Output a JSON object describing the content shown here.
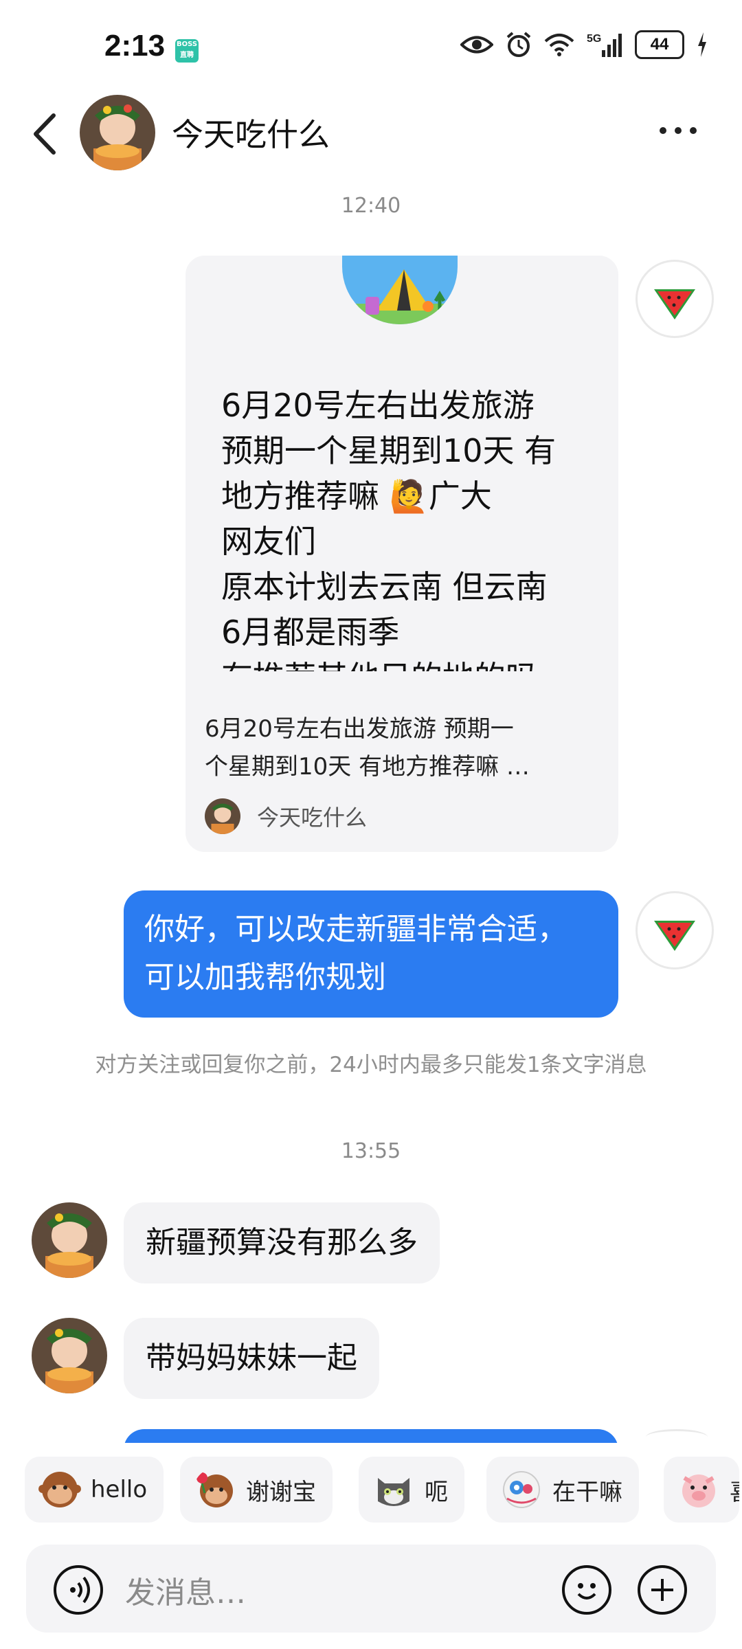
{
  "status_bar": {
    "time": "2:13",
    "boss_badge": "BOSS直聘",
    "network": "5G",
    "battery": "44"
  },
  "header": {
    "title": "今天吃什么",
    "back_icon": "chevron-left-icon",
    "more_icon": "more-dots-icon"
  },
  "messages": {
    "time_1": "12:40",
    "shared_card": {
      "body_lines": [
        "6月20号左右出发旅游",
        "预期一个星期到10天 有",
        "地方推荐嘛 🙋广大",
        "网友们",
        "原本计划去云南 但云南",
        "6月都是雨季",
        "有推荐其他目的地的吗"
      ],
      "summary_lines": [
        "6月20号左右出发旅游 预期一",
        "个星期到10天 有地方推荐嘛 …"
      ],
      "author": "今天吃什么"
    },
    "outgoing_1": "你好，可以改走新疆非常合适，可以加我帮你规划",
    "notice": "对方关注或回复你之前，24小时内最多只能发1条文字消息",
    "time_2": "13:55",
    "incoming_1": "新疆预算没有那么多",
    "incoming_2": "带妈妈妹妹一起"
  },
  "quick_replies": [
    {
      "label": "hello",
      "icon": "monkey-emoji-icon"
    },
    {
      "label": "谢谢宝",
      "icon": "monkey-rose-emoji-icon"
    },
    {
      "label": "呃",
      "icon": "cat-emoji-icon"
    },
    {
      "label": "在干嘛",
      "icon": "mask-emoji-icon"
    },
    {
      "label": "喜",
      "icon": "pig-emoji-icon"
    }
  ],
  "input": {
    "placeholder": "发消息…"
  }
}
